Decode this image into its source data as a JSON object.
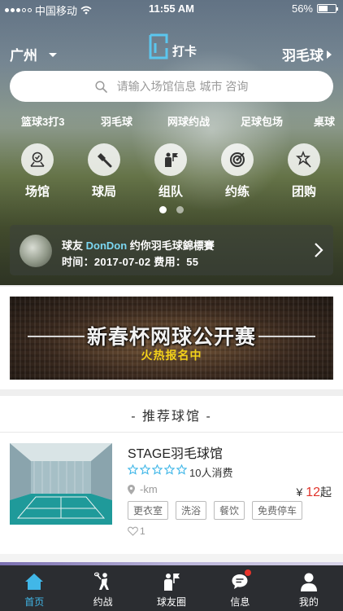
{
  "status_bar": {
    "carrier": "中国移动",
    "time": "11:55 AM",
    "battery": "56%",
    "battery_level": 0.56
  },
  "header": {
    "city": "广州",
    "logo_text": "打卡",
    "sport": "羽毛球"
  },
  "search": {
    "placeholder": "请输入场馆信息 城市 咨询"
  },
  "categories": [
    "篮球3打3",
    "羽毛球",
    "网球约战",
    "足球包场",
    "桌球"
  ],
  "quick_actions": [
    {
      "label": "场馆",
      "icon": "venue-icon"
    },
    {
      "label": "球局",
      "icon": "match-icon"
    },
    {
      "label": "组队",
      "icon": "team-icon"
    },
    {
      "label": "约练",
      "icon": "target-icon"
    },
    {
      "label": "团购",
      "icon": "group-buy-icon"
    }
  ],
  "invite": {
    "prefix": "球友 ",
    "name": "DonDon",
    "text": " 约你羽毛球錦標賽",
    "detail": "时间：2017-07-02  费用：55"
  },
  "banner": {
    "title": "新春杯网球公开赛",
    "subtitle": "火热报名中"
  },
  "recommended": {
    "title": "- 推荐球馆 -",
    "venue": {
      "name": "STAGE羽毛球馆",
      "rating": 5,
      "consume": "10人消费",
      "distance": "-km",
      "price_symbol": "¥ ",
      "price": "12",
      "price_suffix": "起",
      "tags": [
        "更衣室",
        "洗浴",
        "餐饮",
        "免费停车"
      ],
      "likes": "1"
    }
  },
  "tabbar": [
    {
      "label": "首页",
      "icon": "home-icon",
      "active": true
    },
    {
      "label": "约战",
      "icon": "battle-icon",
      "active": false
    },
    {
      "label": "球友圈",
      "icon": "friends-icon",
      "active": false
    },
    {
      "label": "信息",
      "icon": "message-icon",
      "active": false,
      "badge": true
    },
    {
      "label": "我的",
      "icon": "profile-icon",
      "active": false
    }
  ],
  "colors": {
    "accent": "#41b7e8",
    "price": "#e0342b",
    "tabbar_bg": "#2b2d31",
    "banner_subtitle": "#f3d11a"
  }
}
